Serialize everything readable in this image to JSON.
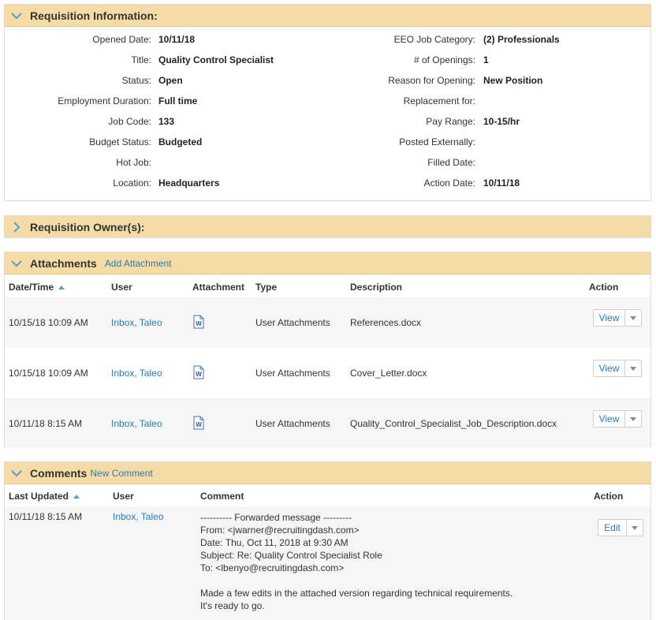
{
  "requisition": {
    "title": "Requisition Information:",
    "left_fields": [
      {
        "label": "Opened Date:",
        "value": "10/11/18"
      },
      {
        "label": "Title:",
        "value": "Quality Control Specialist"
      },
      {
        "label": "Status:",
        "value": "Open"
      },
      {
        "label": "Employment Duration:",
        "value": "Full time"
      },
      {
        "label": "Job Code:",
        "value": "133"
      },
      {
        "label": "Budget Status:",
        "value": "Budgeted"
      },
      {
        "label": "Hot Job:",
        "value": ""
      },
      {
        "label": "Location:",
        "value": "Headquarters"
      }
    ],
    "right_fields": [
      {
        "label": "EEO Job Category:",
        "value": "(2) Professionals"
      },
      {
        "label": "# of Openings:",
        "value": "1"
      },
      {
        "label": "Reason for Opening:",
        "value": "New Position"
      },
      {
        "label": "Replacement for:",
        "value": ""
      },
      {
        "label": "Pay Range:",
        "value": "10-15/hr"
      },
      {
        "label": "Posted Externally:",
        "value": ""
      },
      {
        "label": "Filled Date:",
        "value": ""
      },
      {
        "label": "Action Date:",
        "value": "10/11/18"
      }
    ]
  },
  "owners": {
    "title": "Requisition Owner(s):"
  },
  "attachments": {
    "title": "Attachments",
    "add_link": "Add Attachment",
    "columns": [
      "Date/Time",
      "User",
      "Attachment",
      "Type",
      "Description",
      "Action"
    ],
    "rows": [
      {
        "datetime": "10/15/18 10:09 AM",
        "user": "Inbox, Taleo",
        "type": "User Attachments",
        "description": "References.docx",
        "action": "View"
      },
      {
        "datetime": "10/15/18 10:09 AM",
        "user": "Inbox, Taleo",
        "type": "User Attachments",
        "description": "Cover_Letter.docx",
        "action": "View"
      },
      {
        "datetime": "10/11/18 8:15 AM",
        "user": "Inbox, Taleo",
        "type": "User Attachments",
        "description": "Quality_Control_Specialist_Job_Description.docx",
        "action": "View"
      }
    ]
  },
  "comments": {
    "title": "Comments",
    "new_link": "New Comment",
    "columns": [
      "Last Updated",
      "User",
      "Comment",
      "Action"
    ],
    "row": {
      "updated": "10/11/18 8:15 AM",
      "user": "Inbox, Taleo",
      "action": "Edit",
      "lines": [
        "---------- Forwarded message ---------",
        "From: <jwarner@recruitingdash.com>",
        "Date: Thu, Oct 11, 2018 at 9:30 AM",
        "Subject: Re: Quality Control Specialist Role",
        "To: <lbenyo@recruitingdash.com>",
        "",
        "Made a few edits in the attached version regarding technical requirements.",
        "It's ready to go."
      ]
    }
  },
  "colors": {
    "header_bg": "#f5dca6",
    "link": "#2a7ab8",
    "chevron": "#5b9bd5"
  },
  "icons": {
    "expanded": "chevron-down-icon",
    "collapsed": "chevron-right-icon",
    "attachment": "word-document-icon",
    "sort": "sort-ascending-icon"
  }
}
